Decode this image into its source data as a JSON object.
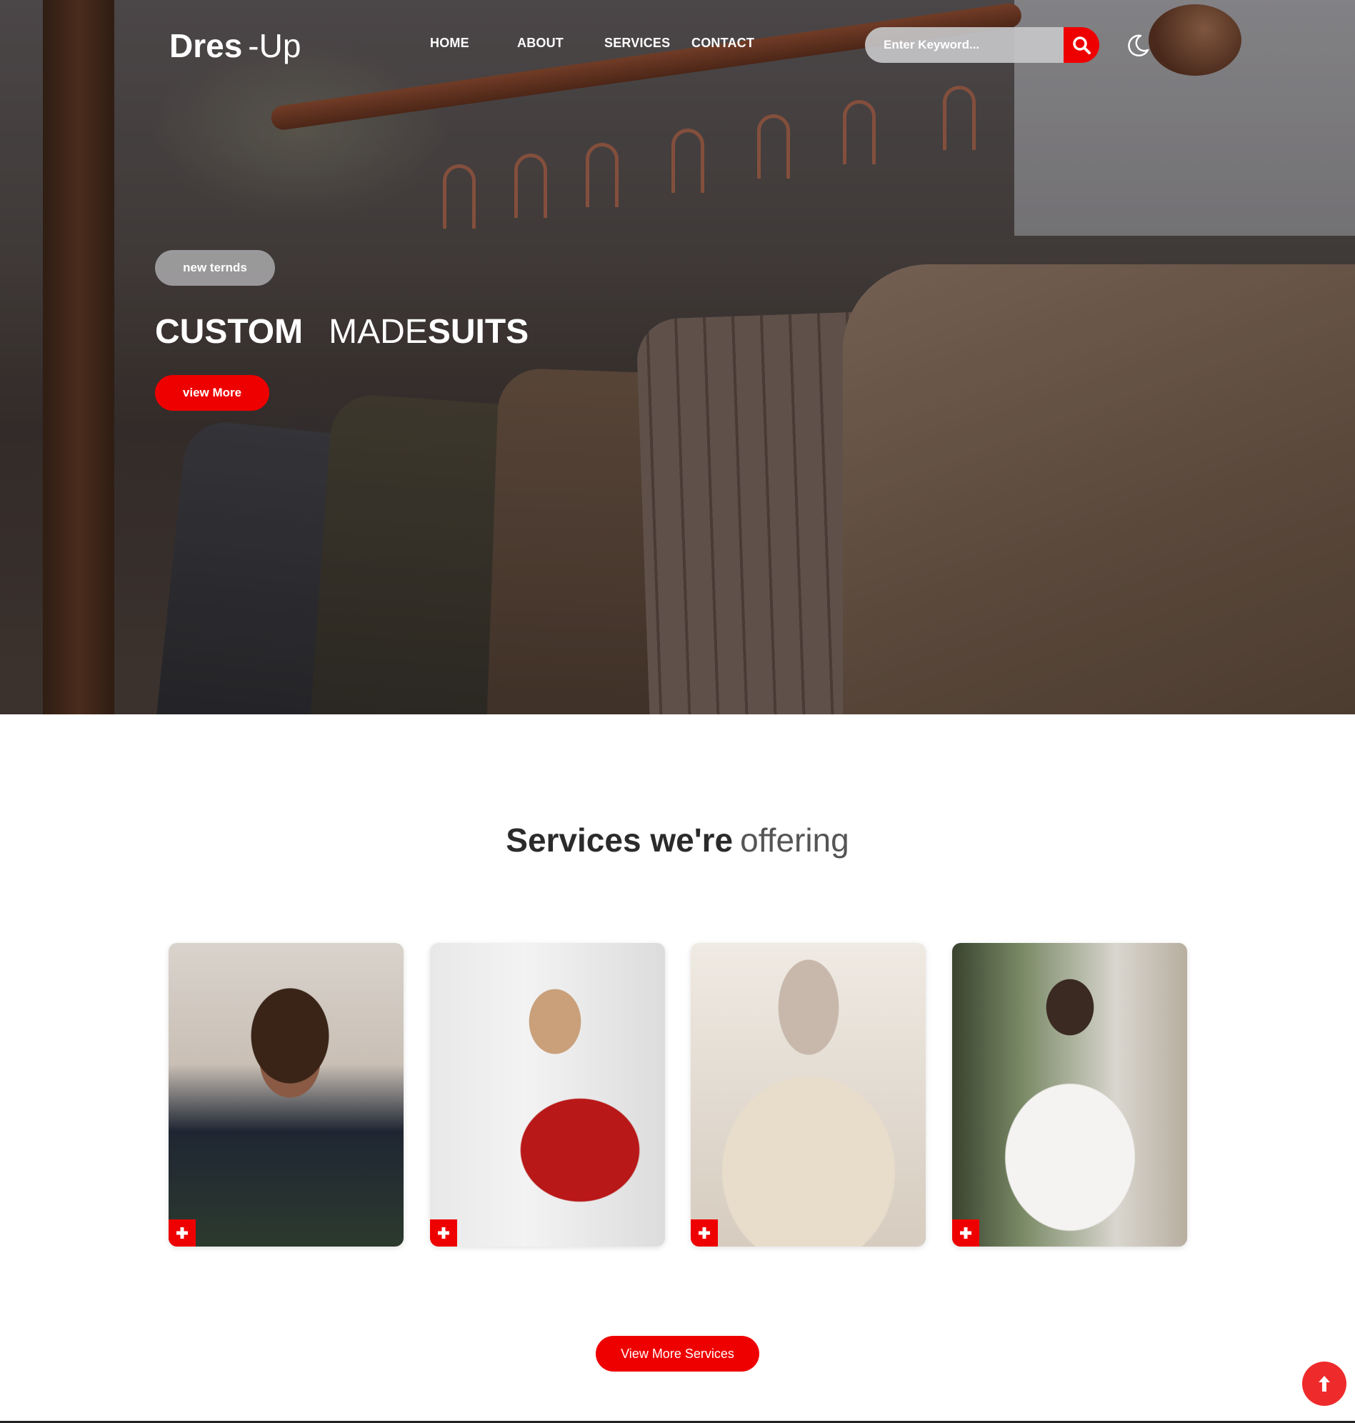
{
  "brand": {
    "bold": "Dres",
    "light": "-Up"
  },
  "nav": {
    "items": [
      {
        "label": "HOME"
      },
      {
        "label": "ABOUT"
      },
      {
        "label": "SERVICES"
      },
      {
        "label": "CONTACT"
      }
    ]
  },
  "search": {
    "placeholder": "Enter Keyword..."
  },
  "icons": {
    "search": "search-icon",
    "theme": "moon-icon",
    "card": "plus-icon",
    "scroll": "arrow-up-icon"
  },
  "hero": {
    "tag": "new ternds",
    "headline": {
      "part1": "CUSTOM",
      "part2": "MADE",
      "part3": "SUITS"
    },
    "button": "view More"
  },
  "services": {
    "title_bold": "Services we're",
    "title_light": "offering",
    "cards": [
      {
        "image": "woman-measuring-tape-photo"
      },
      {
        "image": "woman-sewing-machine-photo"
      },
      {
        "image": "mannequin-cutting-photo"
      },
      {
        "image": "woman-hand-stitching-photo"
      }
    ],
    "button": "View More Services"
  },
  "colors": {
    "accent": "#ef0000",
    "text_dark": "#2b2b2b"
  }
}
